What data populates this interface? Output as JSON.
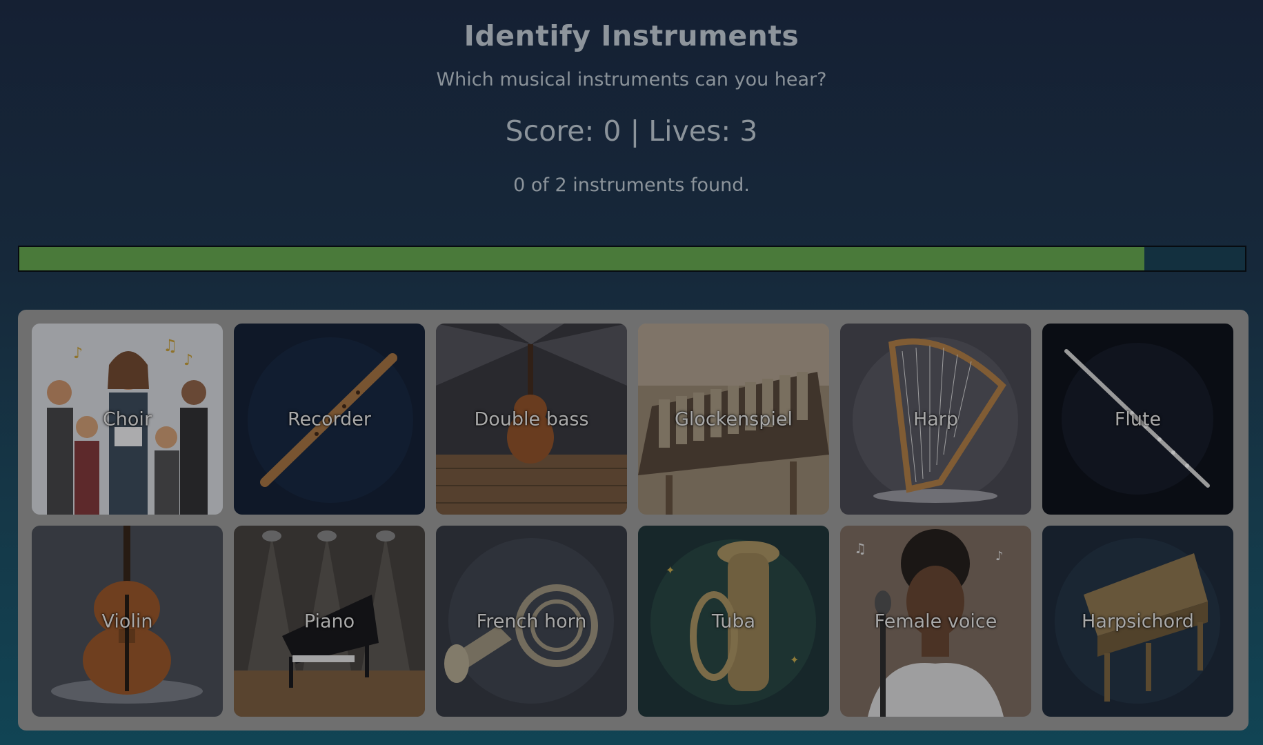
{
  "header": {
    "title": "Identify Instruments",
    "subtitle": "Which musical instruments can you hear?",
    "score_line": "Score: 0 | Lives: 3",
    "found_line": "0 of 2 instruments found."
  },
  "progress": {
    "fraction": 0.918,
    "fill_color": "#4a7a3a"
  },
  "cards": [
    {
      "label": "Choir",
      "icon": "choir-icon"
    },
    {
      "label": "Recorder",
      "icon": "recorder-icon"
    },
    {
      "label": "Double bass",
      "icon": "double-bass-icon"
    },
    {
      "label": "Glockenspiel",
      "icon": "glockenspiel-icon"
    },
    {
      "label": "Harp",
      "icon": "harp-icon"
    },
    {
      "label": "Flute",
      "icon": "flute-icon"
    },
    {
      "label": "Violin",
      "icon": "violin-icon"
    },
    {
      "label": "Piano",
      "icon": "piano-icon"
    },
    {
      "label": "French horn",
      "icon": "french-horn-icon"
    },
    {
      "label": "Tuba",
      "icon": "tuba-icon"
    },
    {
      "label": "Female voice",
      "icon": "female-voice-icon"
    },
    {
      "label": "Harpsichord",
      "icon": "harpsichord-icon"
    }
  ]
}
